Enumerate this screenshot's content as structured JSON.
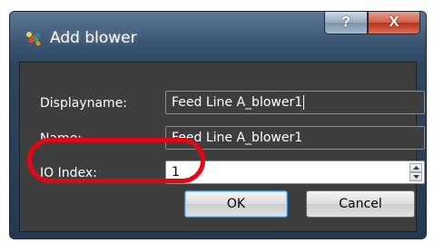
{
  "window": {
    "title": "Add blower",
    "help_glyph": "?",
    "close_glyph": "X",
    "icon": "blower-app-icon"
  },
  "form": {
    "displayname_label": "Displayname:",
    "displayname_value": "Feed Line A_blower1",
    "name_label": "Name:",
    "name_value": "Feed Line A_blower1",
    "io_index_label": "IO Index:",
    "io_index_value": "1"
  },
  "buttons": {
    "ok": "OK",
    "cancel": "Cancel"
  },
  "colors": {
    "annotation": "#e30613",
    "client_bg": "#3e3e3e",
    "close_red": "#c0412a"
  }
}
